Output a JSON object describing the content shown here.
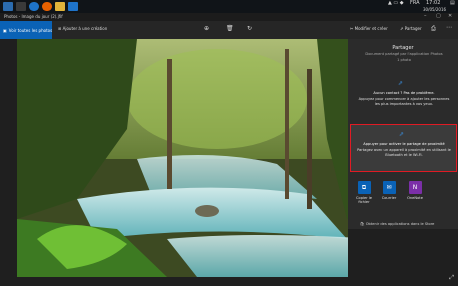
{
  "taskbar": {
    "time": "17:02",
    "date": "30/05/2016",
    "language": "FRA",
    "icons": [
      "start-icon",
      "taskview-icon",
      "edge-icon",
      "firefox-icon",
      "file-explorer-icon",
      "photos-icon"
    ]
  },
  "window": {
    "title": "Photos - Image du jour (2).jfif"
  },
  "toolbar": {
    "all_photos_label": "Voir toutes les photos",
    "add_creation_label": "Ajouter à une création",
    "edit_label": "Modifier et créer",
    "share_label": "Partager"
  },
  "share_panel": {
    "title": "Partager",
    "subtitle": "Document partagé par l'application Photos",
    "count": "1 photo",
    "no_contact_title": "Aucun contact ? Pas de problème.",
    "no_contact_text": "Appuyez pour commencer à ajouter les personnes les plus importantes à vos yeux.",
    "proximity_title": "Appuyer pour activer le partage de proximité",
    "proximity_text": "Partagez avec un appareil à proximité en utilisant le Bluetooth et le Wi-Fi.",
    "apps": [
      {
        "label": "Copier le fichier",
        "color": "#0a62b6",
        "icon": "copy-file-icon"
      },
      {
        "label": "Courrier",
        "color": "#0a62b6",
        "icon": "mail-icon"
      },
      {
        "label": "OneNote",
        "color": "#7b2fa8",
        "icon": "onenote-icon"
      }
    ],
    "store_link": "Obtenir des applications dans le Store"
  }
}
